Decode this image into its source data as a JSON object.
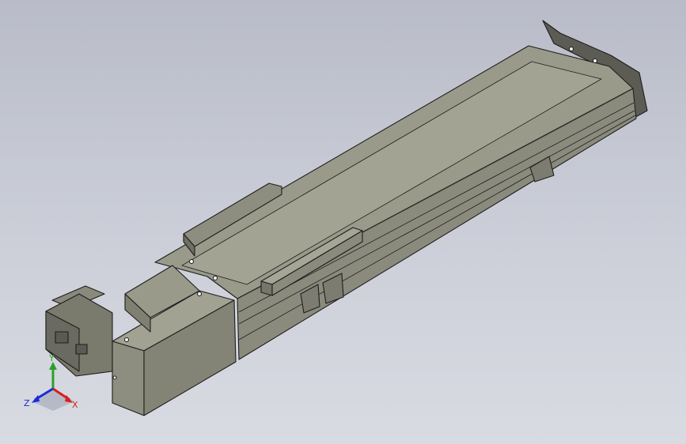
{
  "viewport": {
    "background_top": "#b9bcc8",
    "background_bottom": "#d9dbe3"
  },
  "model": {
    "body_color": "#8f8f80",
    "edge_color": "#202020"
  },
  "triad": {
    "x_label": "X",
    "y_label": "Y",
    "z_label": "Z",
    "x_color": "#d81e1e",
    "y_color": "#2aa02a",
    "z_color": "#1e2ad8"
  }
}
